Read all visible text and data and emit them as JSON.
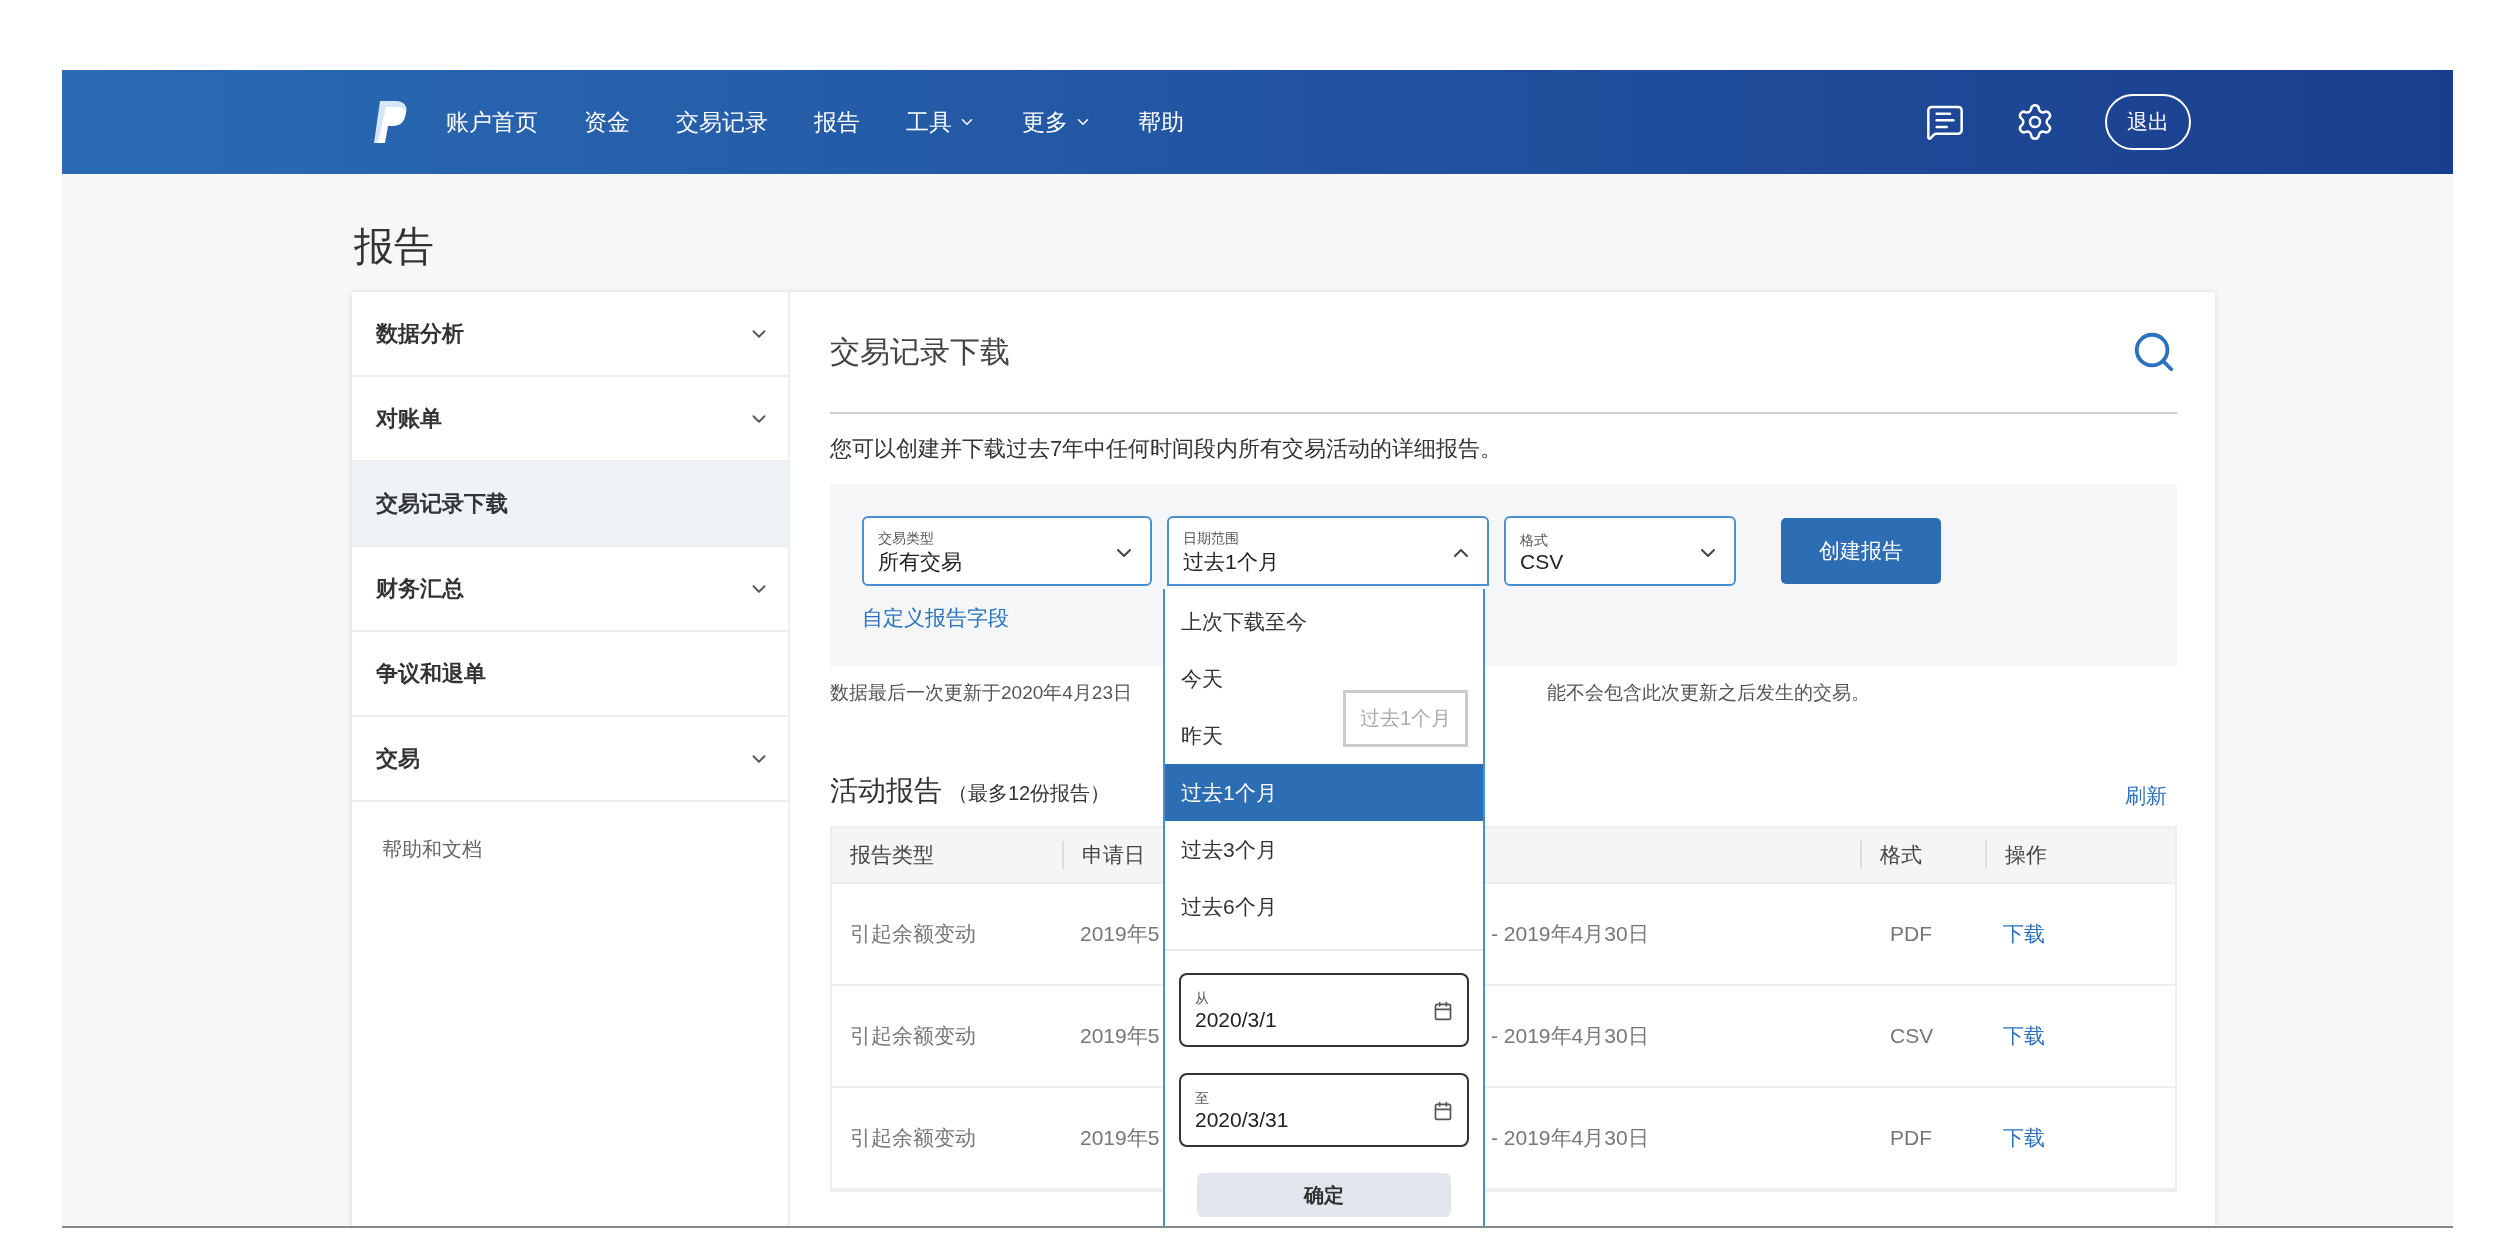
{
  "nav": {
    "items": [
      {
        "label": "账户首页",
        "has_menu": false
      },
      {
        "label": "资金",
        "has_menu": false
      },
      {
        "label": "交易记录",
        "has_menu": false
      },
      {
        "label": "报告",
        "has_menu": false
      },
      {
        "label": "工具",
        "has_menu": true
      },
      {
        "label": "更多",
        "has_menu": true
      },
      {
        "label": "帮助",
        "has_menu": false
      }
    ],
    "logout": "退出"
  },
  "page_title": "报告",
  "sidebar": {
    "items": [
      {
        "label": "数据分析",
        "expandable": true,
        "selected": false
      },
      {
        "label": "对账单",
        "expandable": true,
        "selected": false
      },
      {
        "label": "交易记录下载",
        "expandable": false,
        "selected": true
      },
      {
        "label": "财务汇总",
        "expandable": true,
        "selected": false
      },
      {
        "label": "争议和退单",
        "expandable": false,
        "selected": false
      },
      {
        "label": "交易",
        "expandable": true,
        "selected": false
      }
    ],
    "help_link": "帮助和文档"
  },
  "section": {
    "title": "交易记录下载",
    "description": "您可以创建并下载过去7年中任何时间段内所有交易活动的详细报告。"
  },
  "filters": {
    "fields": [
      {
        "label": "交易类型",
        "value": "所有交易",
        "expanded": false
      },
      {
        "label": "日期范围",
        "value": "过去1个月",
        "expanded": true
      },
      {
        "label": "格式",
        "value": "CSV",
        "expanded": false
      }
    ],
    "create_button": "创建报告",
    "custom_link": "自定义报告字段"
  },
  "note": {
    "left": "数据最后一次更新于2020年4月23日",
    "right": "能不会包含此次更新之后发生的交易。"
  },
  "dropdown": {
    "options": [
      {
        "label": "上次下载至今",
        "selected": false
      },
      {
        "label": "今天",
        "selected": false
      },
      {
        "label": "昨天",
        "selected": false
      },
      {
        "label": "过去1个月",
        "selected": true
      },
      {
        "label": "过去3个月",
        "selected": false
      },
      {
        "label": "过去6个月",
        "selected": false
      }
    ],
    "date_fields": [
      {
        "label": "从",
        "value": "2020/3/1"
      },
      {
        "label": "至",
        "value": "2020/3/31"
      }
    ],
    "confirm": "确定"
  },
  "tooltip": "过去1个月",
  "activity": {
    "title": "活动报告",
    "subtitle": "（最多12份报告）",
    "refresh": "刷新"
  },
  "table": {
    "columns": [
      "报告类型",
      "申请日",
      "格式",
      "操作"
    ],
    "rows": [
      {
        "type": "引起余额变动",
        "requested": "2019年5",
        "period": "- 2019年4月30日",
        "format": "PDF",
        "action": "下载"
      },
      {
        "type": "引起余额变动",
        "requested": "2019年5",
        "period": "- 2019年4月30日",
        "format": "CSV",
        "action": "下载"
      },
      {
        "type": "引起余额变动",
        "requested": "2019年5",
        "period": "- 2019年4月30日",
        "format": "PDF",
        "action": "下载"
      }
    ]
  }
}
